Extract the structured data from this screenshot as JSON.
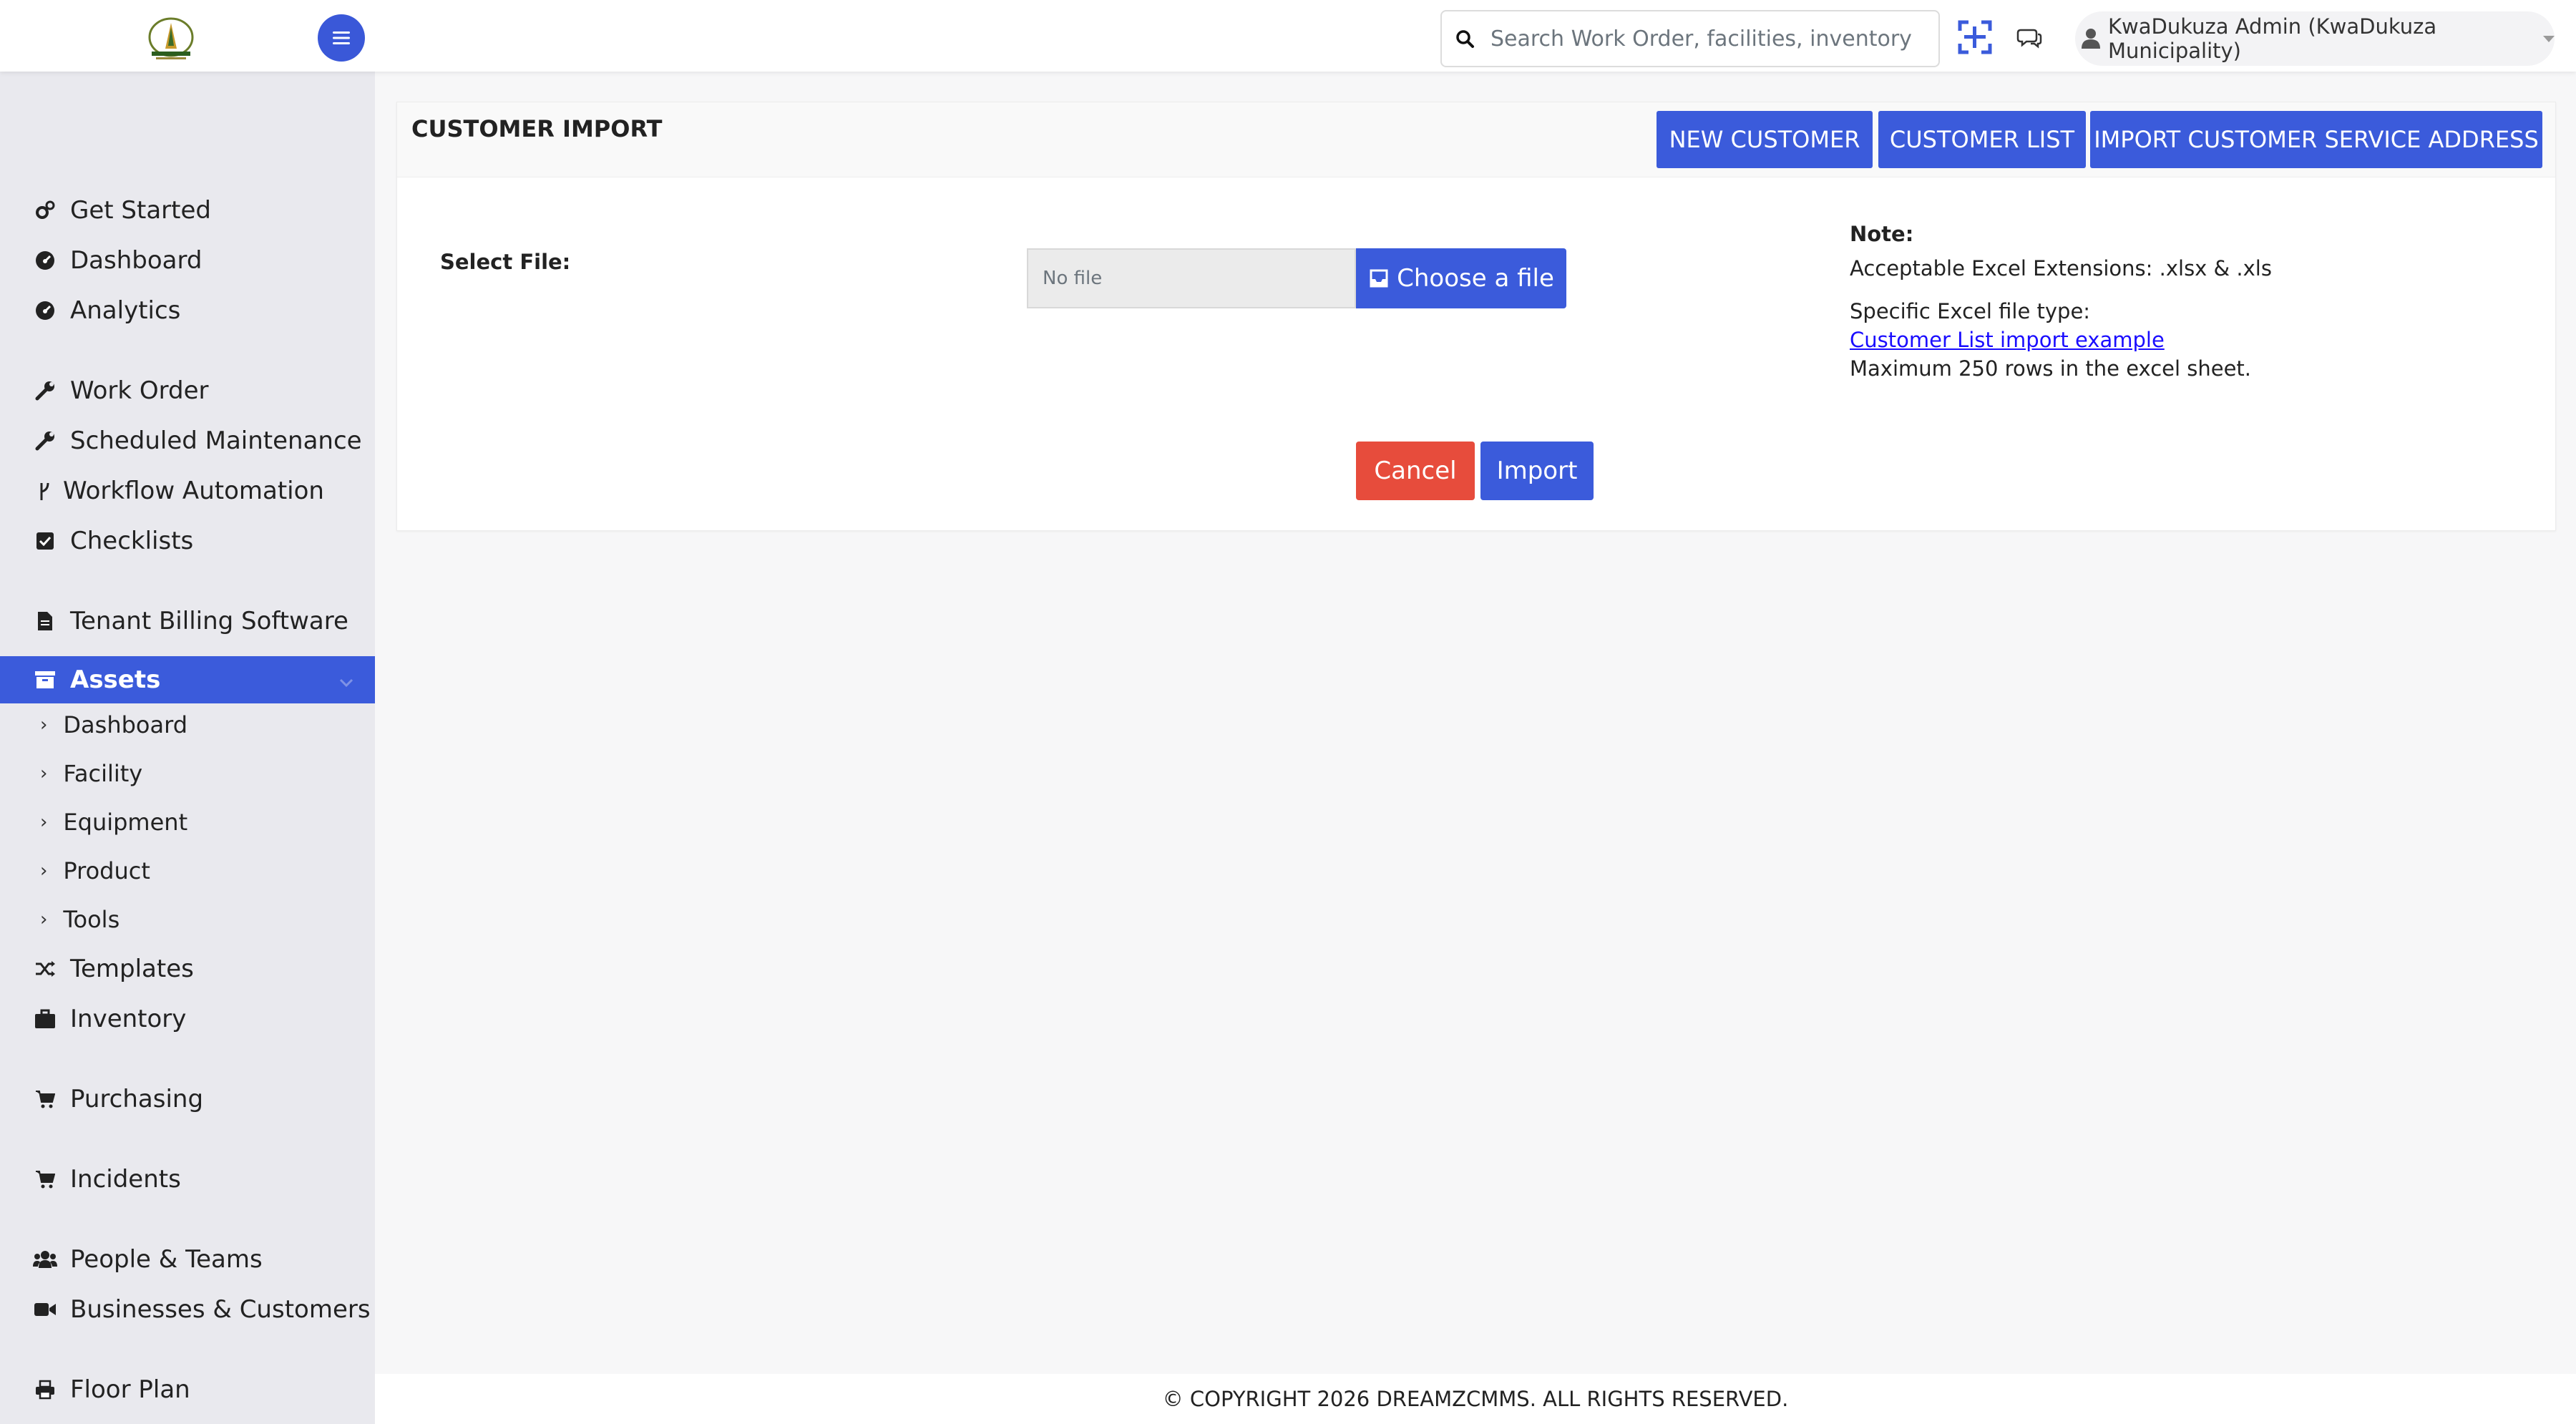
{
  "topbar": {
    "search_placeholder": "Search Work Order, facilities, inventory etc...",
    "user_label": "KwaDukuza Admin (KwaDukuza Municipality)"
  },
  "sidebar": {
    "items": [
      {
        "label": "Get Started",
        "icon": "gears-icon"
      },
      {
        "label": "Dashboard",
        "icon": "gauge-icon"
      },
      {
        "label": "Analytics",
        "icon": "gauge-icon"
      },
      {
        "label": "Work Order",
        "icon": "wrench-icon"
      },
      {
        "label": "Scheduled Maintenance",
        "icon": "wrench-icon"
      },
      {
        "label": "Workflow Automation",
        "icon": "branch-icon"
      },
      {
        "label": "Checklists",
        "icon": "checkbox-icon"
      },
      {
        "label": "Tenant Billing Software",
        "icon": "document-icon"
      },
      {
        "label": "Assets",
        "icon": "archive-icon"
      },
      {
        "label": "Templates",
        "icon": "shuffle-icon"
      },
      {
        "label": "Inventory",
        "icon": "briefcase-icon"
      },
      {
        "label": "Purchasing",
        "icon": "cart-icon"
      },
      {
        "label": "Incidents",
        "icon": "cart-icon"
      },
      {
        "label": "People & Teams",
        "icon": "users-icon"
      },
      {
        "label": "Businesses & Customers",
        "icon": "video-icon"
      },
      {
        "label": "Floor Plan",
        "icon": "print-icon"
      }
    ],
    "assets_sub": [
      "Dashboard",
      "Facility",
      "Equipment",
      "Product",
      "Tools"
    ]
  },
  "page": {
    "title": "CUSTOMER IMPORT",
    "buttons": {
      "new_customer": "NEW CUSTOMER",
      "customer_list": "CUSTOMER LIST",
      "import_address": "IMPORT CUSTOMER SERVICE ADDRESS"
    },
    "select_file_label": "Select File:",
    "file_placeholder": "No file",
    "choose_file": "Choose a file",
    "note": {
      "title": "Note:",
      "extensions": "Acceptable Excel Extensions: .xlsx & .xls",
      "type_label": "Specific Excel file type:",
      "example_link": "Customer List import example",
      "max_rows": "Maximum 250 rows in the excel sheet."
    },
    "cancel": "Cancel",
    "import": "Import"
  },
  "footer": {
    "copyright": "© COPYRIGHT 2026 DREAMZCMMS. ALL RIGHTS RESERVED."
  },
  "colors": {
    "primary": "#3b5bdb",
    "danger": "#e74c3c",
    "sidebar_bg": "#e9e9ee"
  }
}
